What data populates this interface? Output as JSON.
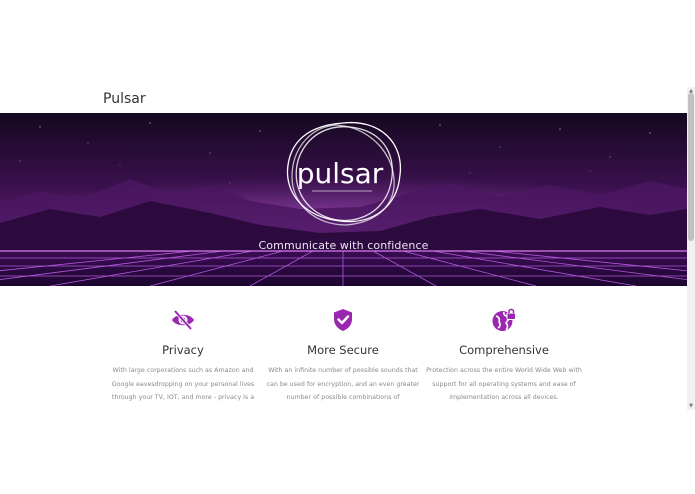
{
  "page": {
    "title": "Pulsar"
  },
  "hero": {
    "logo_text": "pulsar",
    "tagline": "Communicate with confidence",
    "colors": {
      "sky_top": "#1a0b2a",
      "sky_mid": "#5a1a6e",
      "horizon": "#b04fd0",
      "grid": "#d46bff"
    }
  },
  "features": [
    {
      "icon": "eye-slash-icon",
      "title": "Privacy",
      "text": "With large corporations such as Amazon and Google eavesdropping on your personal lives through your TV, IOT, and more - privacy is a"
    },
    {
      "icon": "shield-check-icon",
      "title": "More Secure",
      "text": "With an infinite number of possible sounds that can be used for encryption, and an even greater number of possible combinations of"
    },
    {
      "icon": "globe-lock-icon",
      "title": "Comprehensive",
      "text": "Protection across the entire World Wide Web with support for all operating systems and ease of implementation across all devices."
    }
  ],
  "accent_color": "#9b27b0"
}
